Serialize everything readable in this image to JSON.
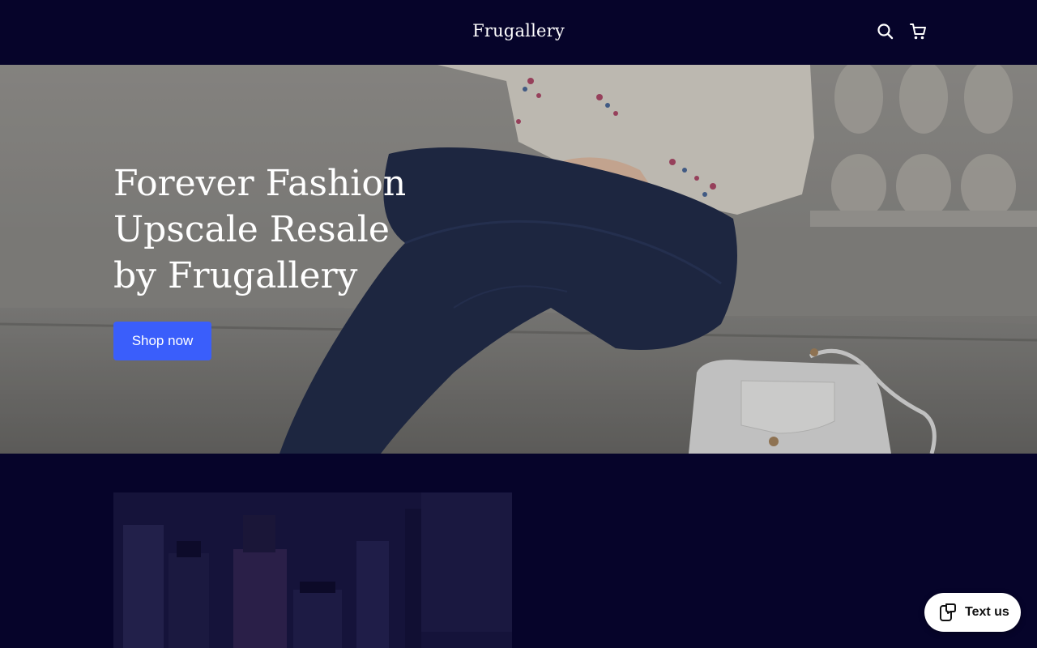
{
  "header": {
    "brand": "Frugallery",
    "icons": [
      "search-icon",
      "cart-icon"
    ]
  },
  "hero": {
    "title": "Forever Fashion\nUpscale Resale\nby Frugallery",
    "cta_label": "Shop now"
  },
  "chat_widget": {
    "label": "Text us",
    "icon": "message-phone-icon"
  },
  "colors": {
    "background": "#06042a",
    "accent": "#3a5efb",
    "text_light": "#ffffff"
  }
}
